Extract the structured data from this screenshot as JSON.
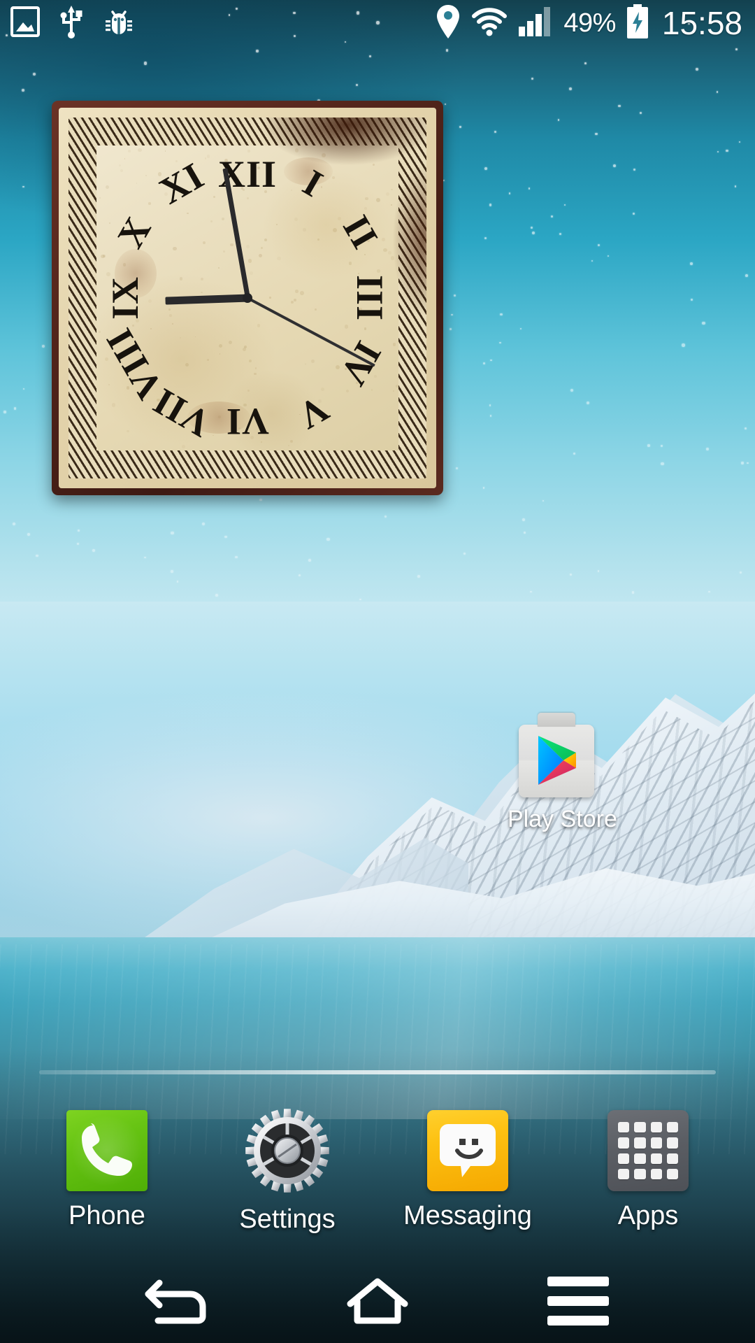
{
  "device": {
    "platform": "android-home-screen",
    "screen": "1080x1920"
  },
  "status_bar": {
    "left_icons": [
      {
        "name": "screenshot-icon",
        "label": "Screenshot captured"
      },
      {
        "name": "usb-icon",
        "label": "USB connected"
      },
      {
        "name": "debug-bug-icon",
        "label": "USB debugging connected"
      }
    ],
    "right_icons": [
      {
        "name": "location-pin-icon",
        "label": "Location on"
      },
      {
        "name": "wifi-icon",
        "label": "Wi-Fi connected",
        "bars": 4
      },
      {
        "name": "cellular-signal-icon",
        "label": "Mobile signal",
        "bars": 3,
        "total_bars": 4
      }
    ],
    "battery": {
      "percent_text": "49%",
      "percent_value": 49,
      "charging": true,
      "icon": "battery-charging-icon"
    },
    "clock": "15:58",
    "text_color": "#ffffff"
  },
  "wallpaper": {
    "name": "snow-mountain-lake-wallpaper",
    "sky_color_top": "#13414f",
    "sky_color_mid": "#2ba6c4",
    "sky_color_low": "#c8e9f2",
    "water_color": "#3d95ab",
    "snow_color": "#ffffff",
    "has_stars": true
  },
  "clock_widget": {
    "name": "vintage-square-analog-clock-widget",
    "style": "antique-parchment",
    "frame_color": "#4a1f16",
    "face_color": "#eadfc0",
    "hand_color": "#2a2a2c",
    "numerals": [
      {
        "label": "XII",
        "hour": 12
      },
      {
        "label": "I",
        "hour": 1
      },
      {
        "label": "II",
        "hour": 2
      },
      {
        "label": "III",
        "hour": 3
      },
      {
        "label": "IV",
        "hour": 4
      },
      {
        "label": "V",
        "hour": 5
      },
      {
        "label": "VI",
        "hour": 6
      },
      {
        "label": "VII",
        "hour": 7
      },
      {
        "label": "VIII",
        "hour": 8
      },
      {
        "label": "IX",
        "hour": 9
      },
      {
        "label": "X",
        "hour": 10
      },
      {
        "label": "XI",
        "hour": 11
      }
    ],
    "hands": {
      "hour_deg": 268,
      "minute_deg": 350,
      "second_deg": 118
    }
  },
  "home_shortcuts": [
    {
      "name": "play-store-shortcut",
      "label": "Play Store",
      "icon": "play-store-icon",
      "icon_colors": {
        "bag": "#e4e4e2",
        "blue": "#00a0ff",
        "green": "#00e676",
        "yellow": "#ffc400",
        "red": "#e02f4e"
      }
    }
  ],
  "dock": {
    "items": [
      {
        "name": "dock-item-phone",
        "label": "Phone",
        "icon": "phone-icon",
        "color": "#66c313"
      },
      {
        "name": "dock-item-settings",
        "label": "Settings",
        "icon": "gear-icon",
        "color": "#c9ccd1"
      },
      {
        "name": "dock-item-messaging",
        "label": "Messaging",
        "icon": "message-icon",
        "color": "#fdc112"
      },
      {
        "name": "dock-item-apps",
        "label": "Apps",
        "icon": "apps-grid-icon",
        "color": "#5b5e64"
      }
    ]
  },
  "nav_bar": {
    "buttons": [
      {
        "name": "nav-back-button",
        "label": "Back",
        "icon": "back-arrow-icon"
      },
      {
        "name": "nav-home-button",
        "label": "Home",
        "icon": "home-icon"
      },
      {
        "name": "nav-menu-button",
        "label": "Menu",
        "icon": "menu-icon"
      }
    ],
    "icon_color": "#ffffff"
  }
}
